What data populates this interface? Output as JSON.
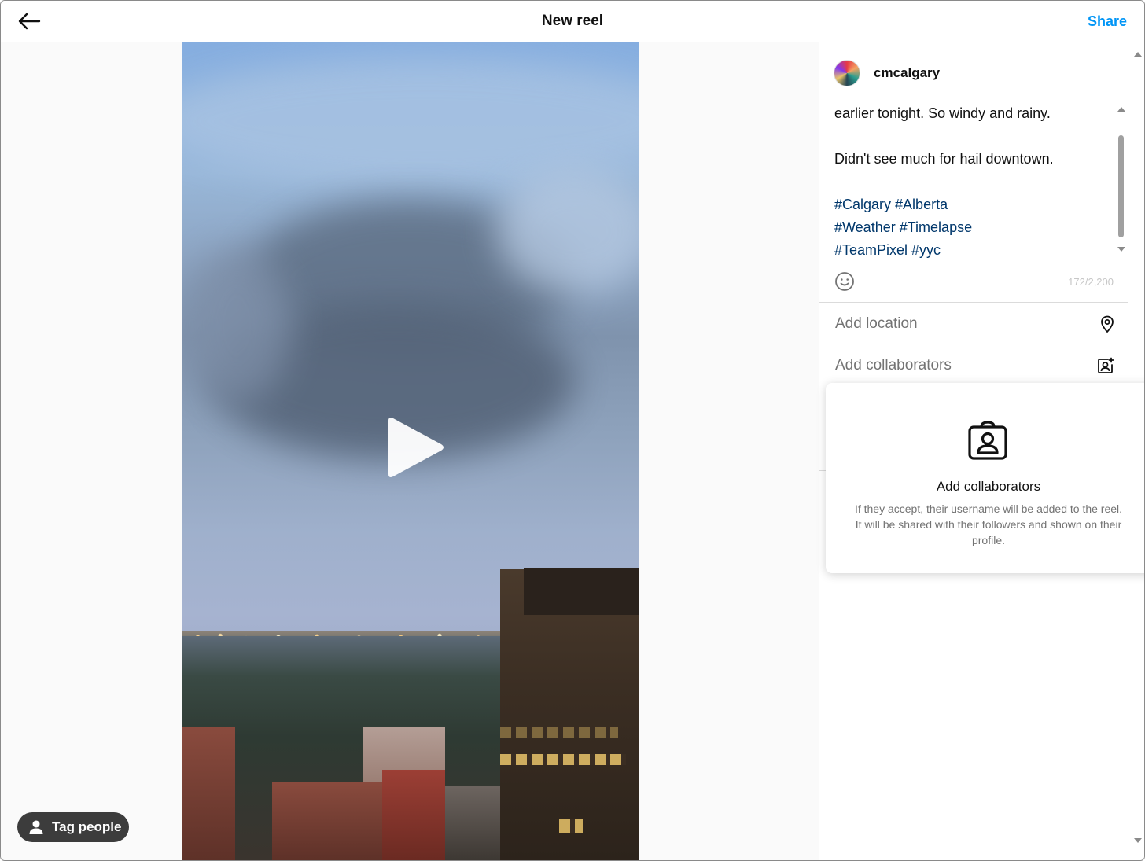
{
  "header": {
    "title": "New reel",
    "share_label": "Share",
    "back_icon": "arrow-left-icon"
  },
  "media": {
    "play_icon": "play-icon",
    "tag_people_label": "Tag people",
    "tag_people_icon": "person-icon"
  },
  "panel": {
    "username": "cmcalgary",
    "caption": {
      "line1": "earlier tonight. So windy and rainy.",
      "line2": "Didn't see much for hail downtown.",
      "hashtags": [
        "#Calgary #Alberta",
        "#Weather #Timelapse",
        "#TeamPixel #yyc"
      ]
    },
    "char_count": "172/2,200",
    "emoji_icon": "smiley-icon",
    "options": {
      "location_label": "Add location",
      "location_icon": "map-pin-icon",
      "collaborators_label": "Add collaborators",
      "collaborators_icon": "person-add-icon"
    }
  },
  "popover": {
    "title": "Add collaborators",
    "description": "If they accept, their username will be added to the reel. It will be shared with their followers and shown on their profile.",
    "icon": "collaborator-badge-icon"
  },
  "colors": {
    "accent": "#0095f6",
    "hashtag": "#00376b",
    "muted": "#737373",
    "divider": "#dbdbdb"
  }
}
